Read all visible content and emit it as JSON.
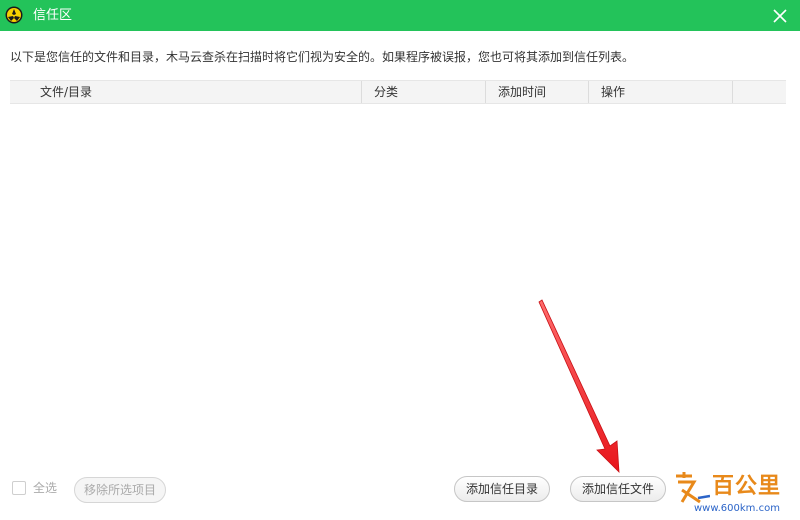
{
  "window": {
    "title": "信任区",
    "brand_color": "#23c35a",
    "close_icon": "close-icon",
    "logo_icon": "app-logo-icon"
  },
  "description": "以下是您信任的文件和目录，木马云查杀在扫描时将它们视为安全的。如果程序被误报，您也可将其添加到信任列表。",
  "table": {
    "columns": [
      "文件/目录",
      "分类",
      "添加时间",
      "操作"
    ],
    "rows": []
  },
  "footer": {
    "select_all_label": "全选",
    "select_all_checked": false,
    "remove_selected_label": "移除所选项目",
    "add_directory_label": "添加信任目录",
    "add_file_label": "添加信任文件"
  },
  "annotation": {
    "arrow_color": "#e8151b"
  },
  "watermark": {
    "text": "百公里",
    "url": "www.600km.com",
    "color": "#e8891a"
  }
}
